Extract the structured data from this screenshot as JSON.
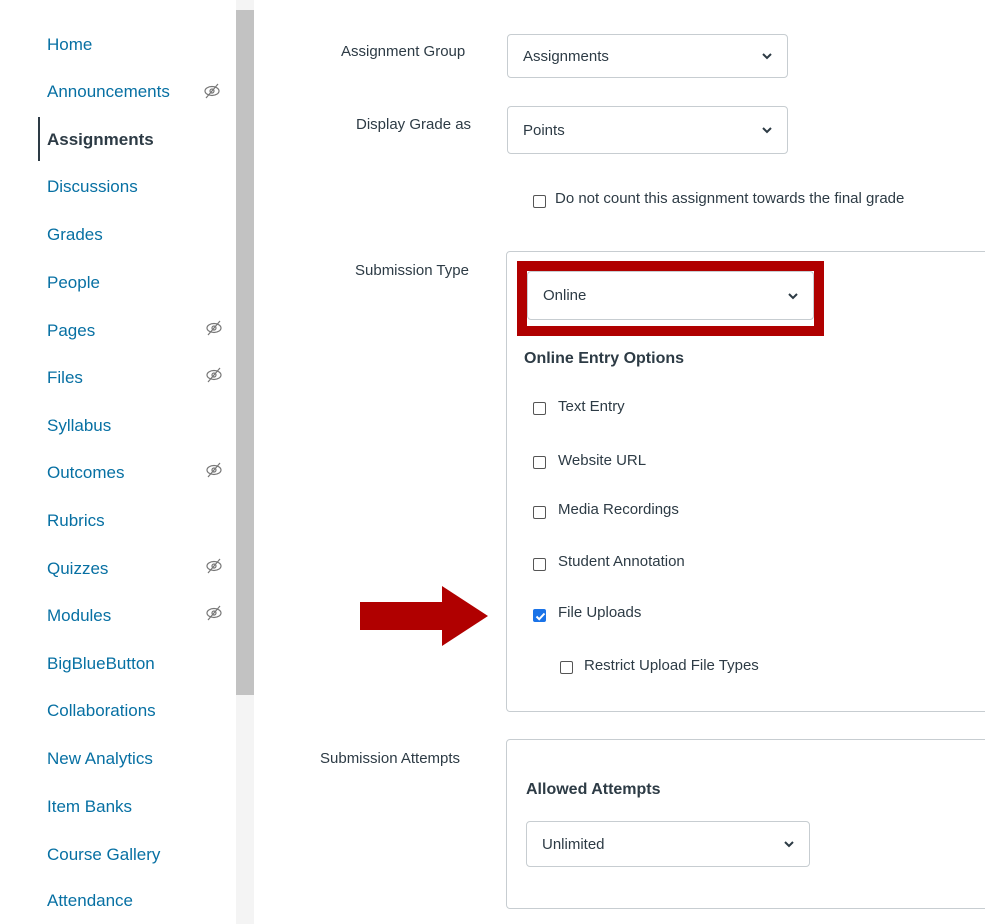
{
  "sidebar": {
    "items": [
      {
        "label": "Home",
        "hidden": false
      },
      {
        "label": "Announcements",
        "hidden": true
      },
      {
        "label": "Assignments",
        "hidden": false,
        "active": true
      },
      {
        "label": "Discussions",
        "hidden": false
      },
      {
        "label": "Grades",
        "hidden": false
      },
      {
        "label": "People",
        "hidden": false
      },
      {
        "label": "Pages",
        "hidden": true
      },
      {
        "label": "Files",
        "hidden": true
      },
      {
        "label": "Syllabus",
        "hidden": false
      },
      {
        "label": "Outcomes",
        "hidden": true
      },
      {
        "label": "Rubrics",
        "hidden": false
      },
      {
        "label": "Quizzes",
        "hidden": true
      },
      {
        "label": "Modules",
        "hidden": true
      },
      {
        "label": "BigBlueButton",
        "hidden": false
      },
      {
        "label": "Collaborations",
        "hidden": false
      },
      {
        "label": "New Analytics",
        "hidden": false
      },
      {
        "label": "Item Banks",
        "hidden": false
      },
      {
        "label": "Course Gallery",
        "hidden": false
      },
      {
        "label": "Attendance",
        "hidden": false
      }
    ]
  },
  "form": {
    "assignment_group": {
      "label": "Assignment Group",
      "value": "Assignments"
    },
    "display_grade": {
      "label": "Display Grade as",
      "value": "Points"
    },
    "exclude_final_grade": {
      "label": "Do not count this assignment towards the final grade",
      "checked": false
    },
    "submission_type": {
      "label": "Submission Type",
      "value": "Online",
      "online_entry_title": "Online Entry Options",
      "options": [
        {
          "label": "Text Entry",
          "checked": false
        },
        {
          "label": "Website URL",
          "checked": false
        },
        {
          "label": "Media Recordings",
          "checked": false
        },
        {
          "label": "Student Annotation",
          "checked": false
        },
        {
          "label": "File Uploads",
          "checked": true
        }
      ],
      "restrict_file_types": {
        "label": "Restrict Upload File Types",
        "checked": false
      }
    },
    "submission_attempts": {
      "label": "Submission Attempts",
      "allowed_title": "Allowed Attempts",
      "value": "Unlimited"
    }
  },
  "colors": {
    "link": "#0770a3",
    "text": "#2d3b45",
    "highlight": "#b00000",
    "checkbox_checked": "#1a73e8"
  },
  "icons": {
    "hidden": "eye-slash-icon",
    "dropdown": "chevron-down-icon",
    "annotation_arrow": "right-arrow-icon"
  }
}
